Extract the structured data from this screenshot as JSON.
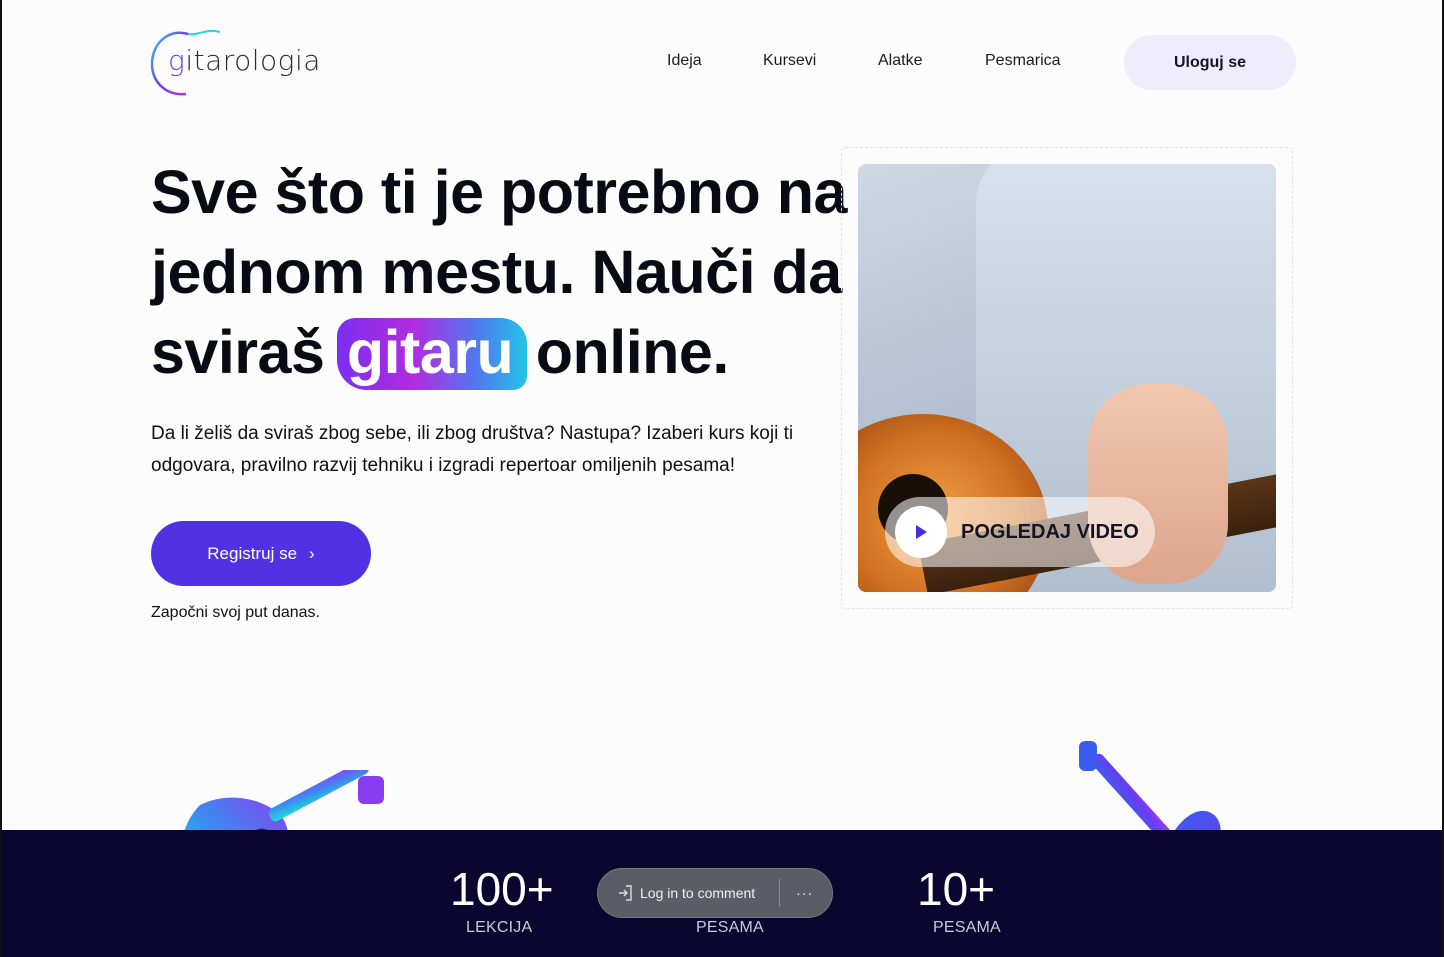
{
  "header": {
    "logo_text_g": "g",
    "logo_text_rest": "itarologia",
    "nav": [
      {
        "label": "Ideja"
      },
      {
        "label": "Kursevi"
      },
      {
        "label": "Alatke"
      },
      {
        "label": "Pesmarica"
      }
    ],
    "login_label": "Uloguj se"
  },
  "hero": {
    "title_line1": "Sve što ti je potrebno na",
    "title_line2": "jednom mestu. Nauči da",
    "title_line3_pre": "sviraš",
    "title_highlight": "gitaru",
    "title_line3_post": "online.",
    "description": "Da li želiš da sviraš zbog sebe, ili zbog društva? Nastupa? Izaberi kurs koji ti odgovara, pravilno razvij tehniku i izgradi repertoar omiljenih pesama!",
    "register_label": "Registruj se",
    "register_chevron": "›",
    "start_note": "Započni svoj put danas."
  },
  "video": {
    "play_label": "POGLEDAJ VIDEO"
  },
  "stats": [
    {
      "value": "100+",
      "label": "LEKCIJA"
    },
    {
      "value": "",
      "label": "PESAMA"
    },
    {
      "value": "10+",
      "label": "PESAMA"
    }
  ],
  "comment_widget": {
    "label": "Log in to comment",
    "more": "···"
  },
  "colors": {
    "accent": "#5132e2",
    "stats_bg": "#0b0630",
    "login_bg": "#efecfb"
  }
}
